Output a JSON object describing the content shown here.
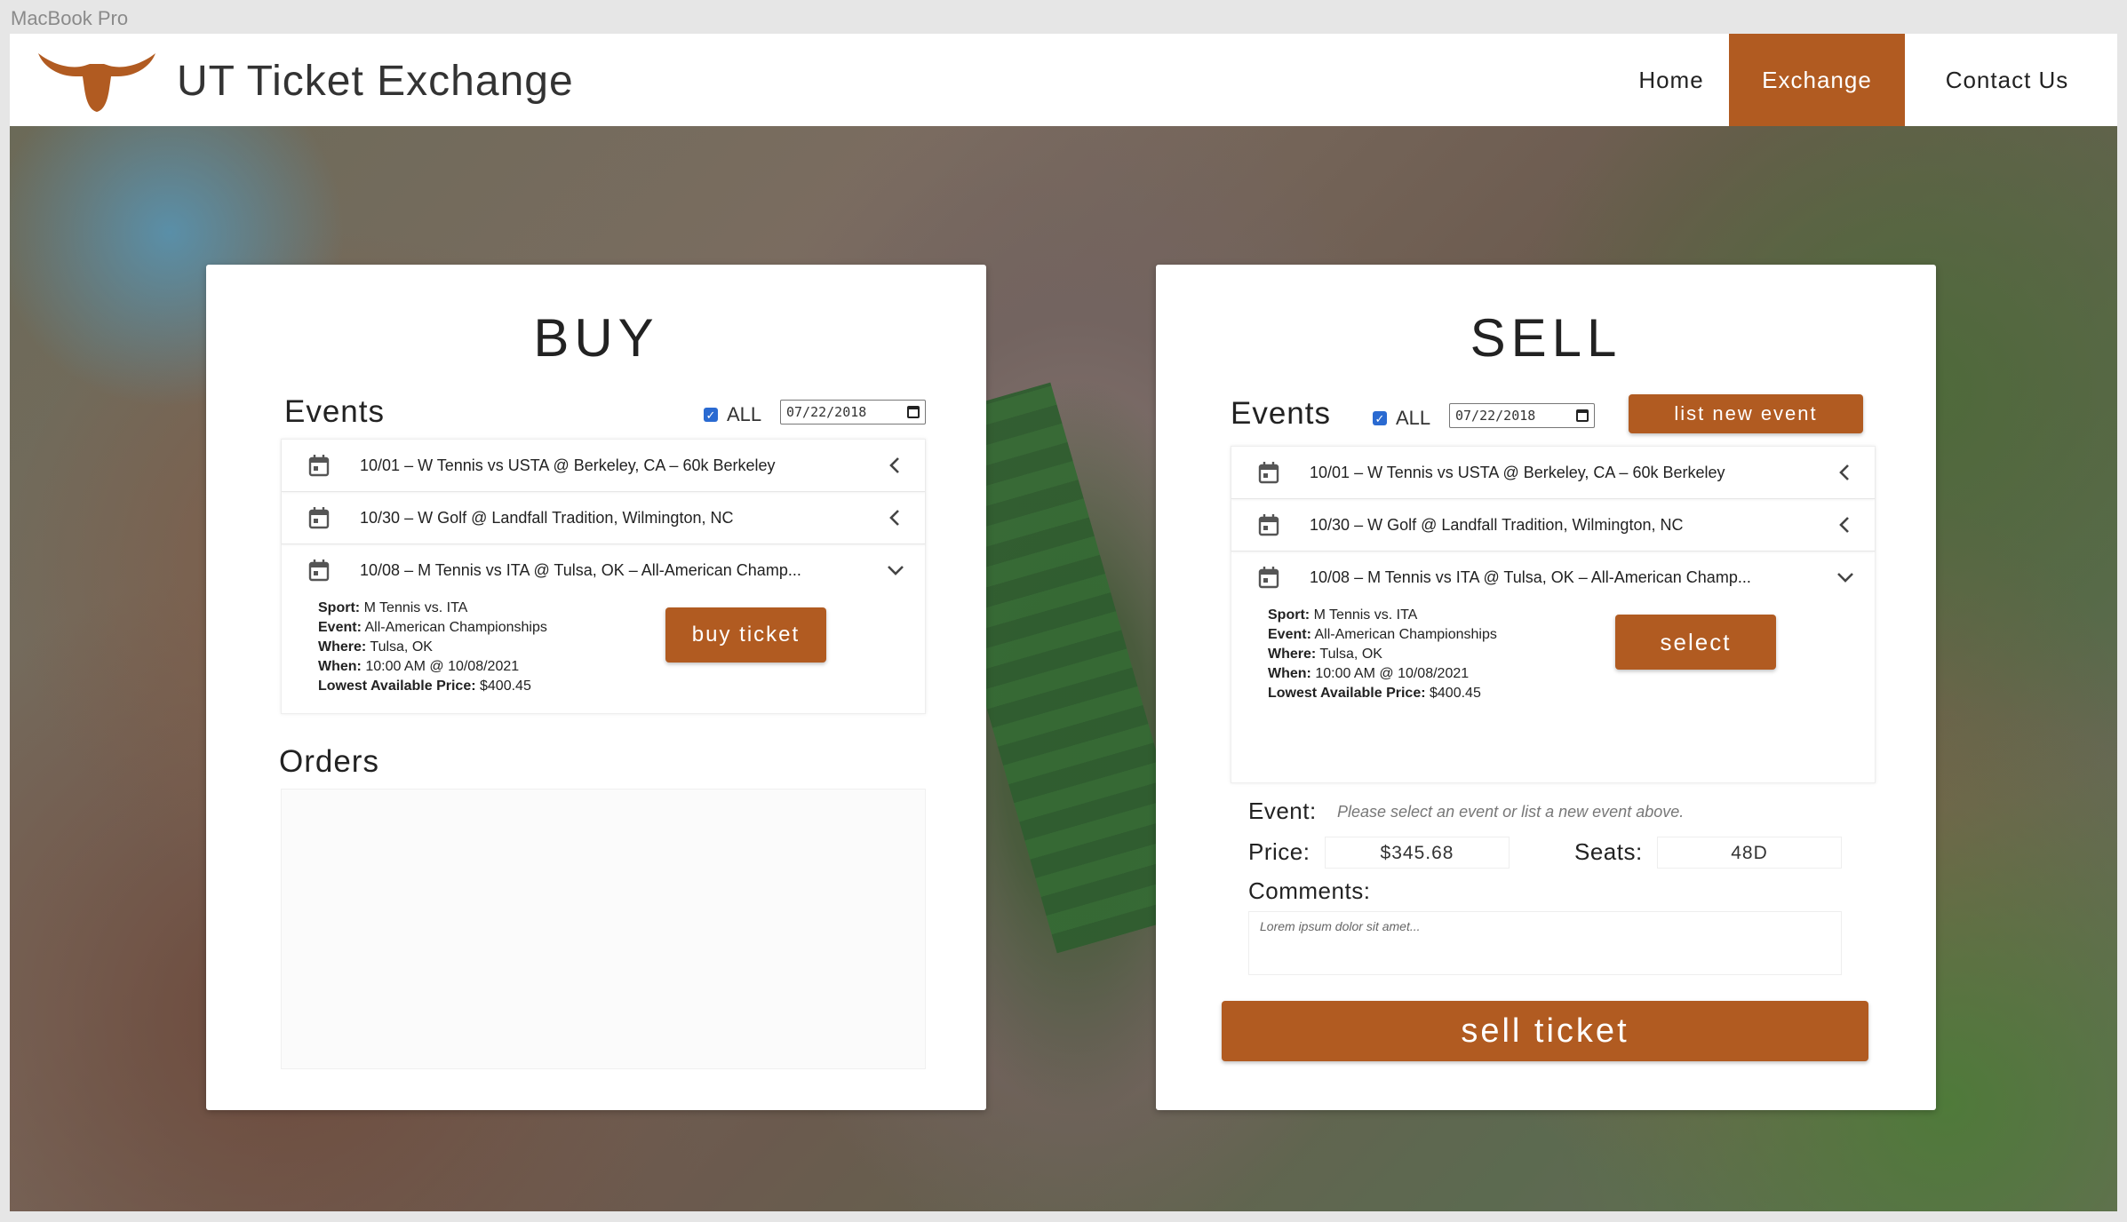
{
  "window": {
    "device_label": "MacBook Pro"
  },
  "nav": {
    "brand": "UT Ticket Exchange",
    "links": [
      {
        "label": "Home",
        "active": false
      },
      {
        "label": "Exchange",
        "active": true
      },
      {
        "label": "Contact Us",
        "active": false
      }
    ],
    "accent_color": "#b15b21"
  },
  "buy": {
    "title": "BUY",
    "events_heading": "Events",
    "all_label": "ALL",
    "all_checked": true,
    "date_value": "07/22/2018",
    "events": [
      {
        "date": "10/01",
        "text": "– W Tennis vs USTA @ Berkeley, CA – 60k Berkeley",
        "expanded": false
      },
      {
        "date": "10/30",
        "text": "– W Golf @ Landfall Tradition, Wilmington, NC",
        "expanded": false
      },
      {
        "date": "10/08",
        "text": "– M Tennis vs ITA @ Tulsa, OK – All-American Champ...",
        "expanded": true
      }
    ],
    "detail": {
      "sport_label": "Sport:",
      "sport": "M Tennis vs. ITA",
      "event_label": "Event:",
      "event": "All-American Championships",
      "where_label": "Where:",
      "where": "Tulsa, OK",
      "when_label": "When:",
      "when": "10:00 AM @ 10/08/2021",
      "price_label": "Lowest Available Price:",
      "price": "$400.45"
    },
    "action_label": "buy ticket",
    "orders_heading": "Orders"
  },
  "sell": {
    "title": "SELL",
    "events_heading": "Events",
    "all_label": "ALL",
    "all_checked": true,
    "date_value": "07/22/2018",
    "list_new_label": "list new event",
    "events": [
      {
        "date": "10/01",
        "text": "– W Tennis vs USTA @ Berkeley, CA – 60k Berkeley",
        "expanded": false
      },
      {
        "date": "10/30",
        "text": "– W Golf @ Landfall Tradition, Wilmington, NC",
        "expanded": false
      },
      {
        "date": "10/08",
        "text": "– M Tennis vs ITA @ Tulsa, OK – All-American Champ...",
        "expanded": true
      }
    ],
    "detail": {
      "sport_label": "Sport:",
      "sport": "M Tennis vs. ITA",
      "event_label": "Event:",
      "event": "All-American Championships",
      "where_label": "Where:",
      "where": "Tulsa, OK",
      "when_label": "When:",
      "when": "10:00 AM @ 10/08/2021",
      "price_label": "Lowest Available Price:",
      "price": "$400.45"
    },
    "action_label": "select",
    "form": {
      "event_label": "Event:",
      "event_hint": "Please select an event or list a new event above.",
      "price_label": "Price:",
      "price_value": "$345.68",
      "seats_label": "Seats:",
      "seats_value": "48D",
      "comments_label": "Comments:",
      "comments_placeholder": "Lorem ipsum dolor sit amet..."
    },
    "submit_label": "sell ticket"
  }
}
